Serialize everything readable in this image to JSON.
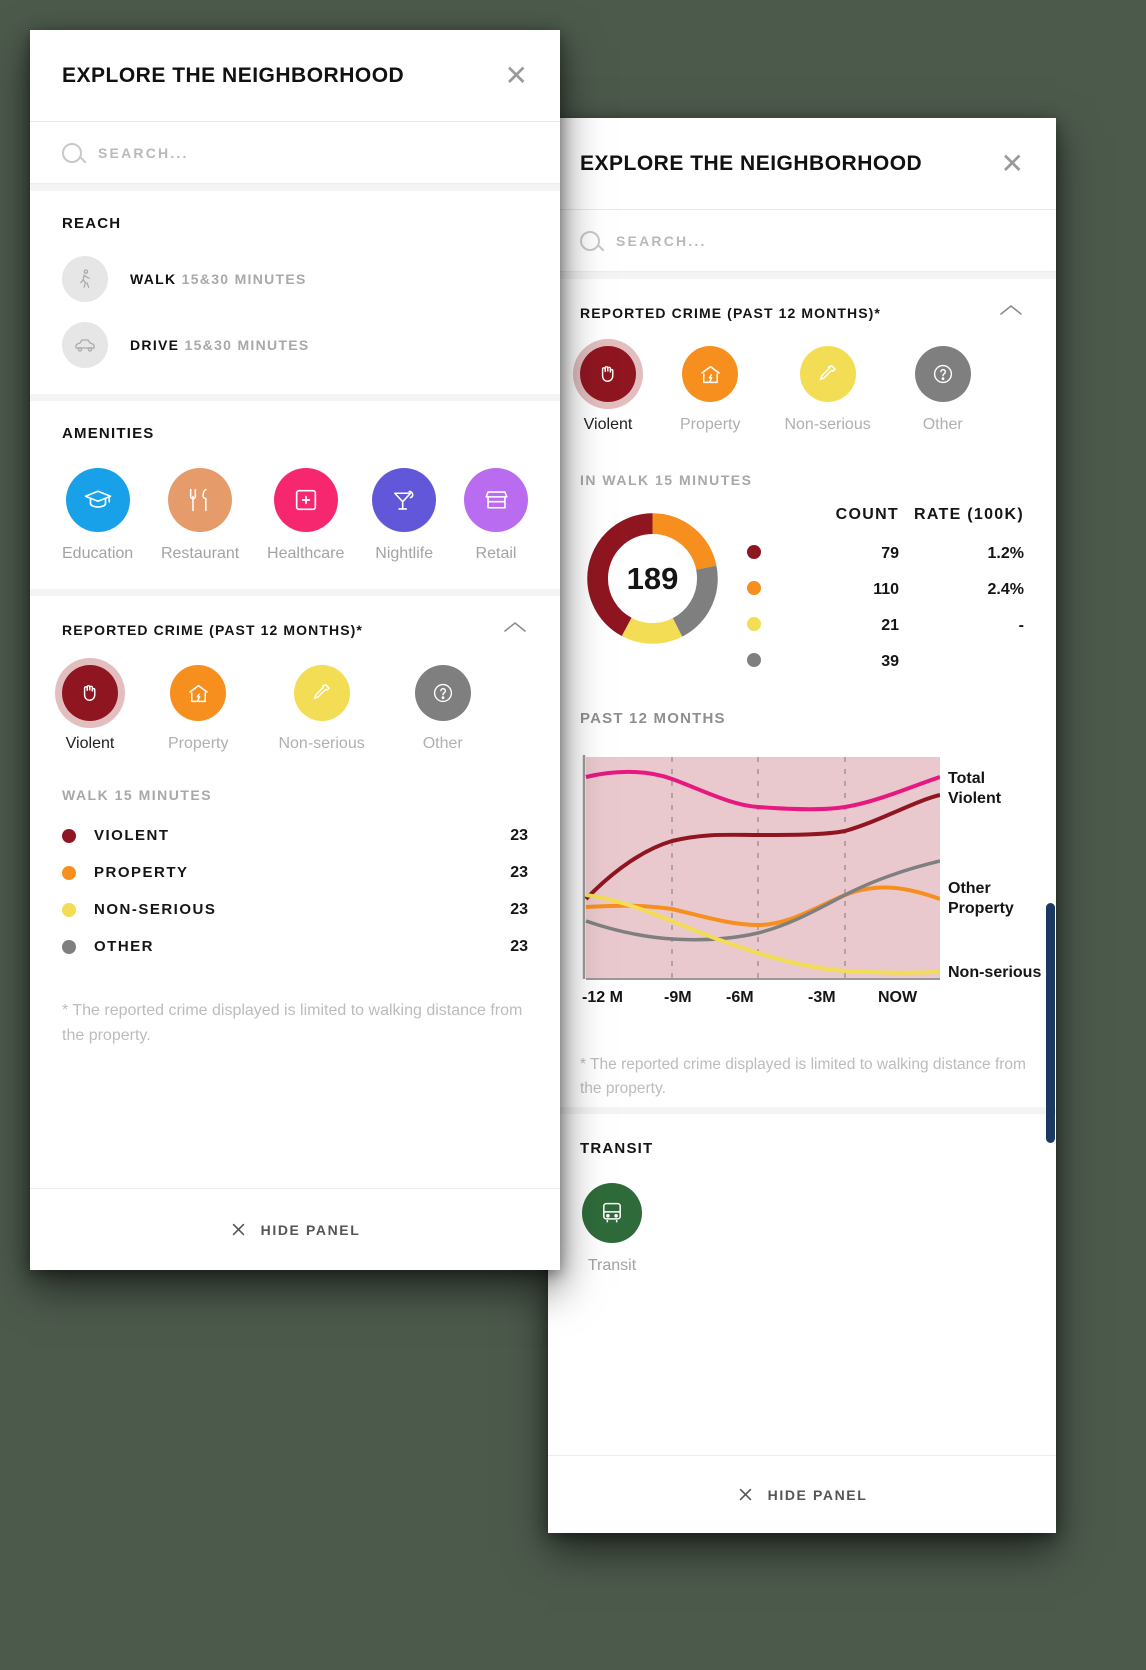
{
  "colors": {
    "violent": "#8f1621",
    "property": "#f78f1e",
    "nonserious": "#f2dd55",
    "other": "#7f7f7f",
    "total": "#e5197f",
    "education": "#18a0e8",
    "restaurant": "#e69b6b",
    "healthcare": "#f7276f",
    "nightlife": "#6157d8",
    "retail": "#b96cf0",
    "transit": "#2f6b3a",
    "area_fill": "#e9c9cd"
  },
  "left_panel": {
    "header": {
      "title": "EXPLORE THE NEIGHBORHOOD",
      "close_icon": "close-icon"
    },
    "search": {
      "placeholder": "SEARCH...",
      "icon": "search-icon"
    },
    "reach": {
      "title": "REACH",
      "items": [
        {
          "icon": "walk-icon",
          "label": "WALK",
          "detail": "15&30 MINUTES"
        },
        {
          "icon": "drive-icon",
          "label": "DRIVE",
          "detail": "15&30 MINUTES"
        }
      ]
    },
    "amenities": {
      "title": "AMENITIES",
      "items": [
        {
          "icon": "graduation-cap-icon",
          "label": "Education",
          "color": "#18a0e8"
        },
        {
          "icon": "fork-knife-icon",
          "label": "Restaurant",
          "color": "#e69b6b"
        },
        {
          "icon": "medical-cross-icon",
          "label": "Healthcare",
          "color": "#f7276f"
        },
        {
          "icon": "cocktail-icon",
          "label": "Nightlife",
          "color": "#6157d8"
        },
        {
          "icon": "storefront-icon",
          "label": "Retail",
          "color": "#b96cf0"
        }
      ]
    },
    "crime": {
      "title": "REPORTED CRIME (PAST 12 MONTHS)*",
      "collapse_icon": "chevron-up-icon",
      "categories": [
        {
          "icon": "fist-icon",
          "label": "Violent",
          "color": "#8f1621",
          "selected": true
        },
        {
          "icon": "house-break-in-icon",
          "label": "Property",
          "color": "#f78f1e",
          "selected": false
        },
        {
          "icon": "bottle-icon",
          "label": "Non-serious",
          "color": "#f2dd55",
          "selected": false
        },
        {
          "icon": "question-mark-icon",
          "label": "Other",
          "color": "#7f7f7f",
          "selected": false
        }
      ],
      "range_label": "WALK 15 MINUTES",
      "rows": [
        {
          "label": "VIOLENT",
          "value": "23",
          "color": "#8f1621"
        },
        {
          "label": "PROPERTY",
          "value": "23",
          "color": "#f78f1e"
        },
        {
          "label": "NON-SERIOUS",
          "value": "23",
          "color": "#f2dd55"
        },
        {
          "label": "OTHER",
          "value": "23",
          "color": "#7f7f7f"
        }
      ],
      "footnote": "* The reported crime displayed is limited to walking distance from the property."
    },
    "hide_panel": {
      "label": "HIDE PANEL",
      "icon": "close-icon"
    }
  },
  "right_panel": {
    "header": {
      "title": "EXPLORE THE NEIGHBORHOOD",
      "close_icon": "close-icon"
    },
    "search": {
      "placeholder": "SEARCH...",
      "icon": "search-icon"
    },
    "crime": {
      "title": "REPORTED CRIME (PAST 12 MONTHS)*",
      "collapse_icon": "chevron-up-icon",
      "categories": [
        {
          "icon": "fist-icon",
          "label": "Violent",
          "color": "#8f1621",
          "selected": true
        },
        {
          "icon": "house-break-in-icon",
          "label": "Property",
          "color": "#f78f1e",
          "selected": false
        },
        {
          "icon": "bottle-icon",
          "label": "Non-serious",
          "color": "#f2dd55",
          "selected": false
        },
        {
          "icon": "question-mark-icon",
          "label": "Other",
          "color": "#7f7f7f",
          "selected": false
        }
      ],
      "range_label": "IN WALK 15 MINUTES",
      "table": {
        "head_count": "COUNT",
        "head_rate": "RATE (100K)",
        "rows": [
          {
            "color": "#8f1621",
            "count": "79",
            "rate": "1.2%"
          },
          {
            "color": "#f78f1e",
            "count": "110",
            "rate": "2.4%"
          },
          {
            "color": "#f2dd55",
            "count": "21",
            "rate": "-"
          },
          {
            "color": "#7f7f7f",
            "count": "39",
            "rate": ""
          }
        ]
      },
      "chart_title": "PAST 12 MONTHS",
      "footnote": "* The reported crime displayed is limited to walking distance from the property."
    },
    "transit": {
      "title": "TRANSIT",
      "items": [
        {
          "icon": "bus-icon",
          "label": "Transit",
          "color": "#2f6b3a"
        }
      ]
    },
    "hide_panel": {
      "label": "HIDE PANEL",
      "icon": "close-icon"
    }
  },
  "chart_data": {
    "type": "line",
    "title": "PAST 12 MONTHS",
    "total_label": "189",
    "xlabel": "",
    "ylabel": "",
    "grid": true,
    "legend_position": "right",
    "categories": [
      "-12 M",
      "-9M",
      "-6M",
      "-3M",
      "NOW"
    ],
    "x": [
      0,
      25,
      50,
      75,
      100
    ],
    "series": [
      {
        "name": "Total",
        "color": "#e5197f",
        "values": [
          88,
          90,
          83,
          80,
          86
        ]
      },
      {
        "name": "Violent",
        "color": "#8f1621",
        "values": [
          40,
          56,
          57,
          58,
          76
        ]
      },
      {
        "name": "Property",
        "color": "#f78f1e",
        "values": [
          35,
          34,
          28,
          36,
          42
        ]
      },
      {
        "name": "Other",
        "color": "#7f7f7f",
        "values": [
          28,
          22,
          22,
          33,
          48
        ]
      },
      {
        "name": "Non-serious",
        "color": "#f2dd55",
        "values": [
          42,
          33,
          22,
          11,
          8
        ]
      }
    ],
    "axis_ticks": [
      "-12 M",
      "-9M",
      "-6M",
      "-3M",
      "NOW"
    ],
    "donut": {
      "type": "pie",
      "center_value": "189",
      "slices": [
        {
          "name": "Violent",
          "value": 79,
          "color": "#8f1621"
        },
        {
          "name": "Property",
          "value": 110,
          "color": "#f78f1e"
        },
        {
          "name": "Other",
          "value": 39,
          "color": "#7f7f7f"
        },
        {
          "name": "Non-serious",
          "value": 21,
          "color": "#f2dd55"
        }
      ]
    }
  }
}
